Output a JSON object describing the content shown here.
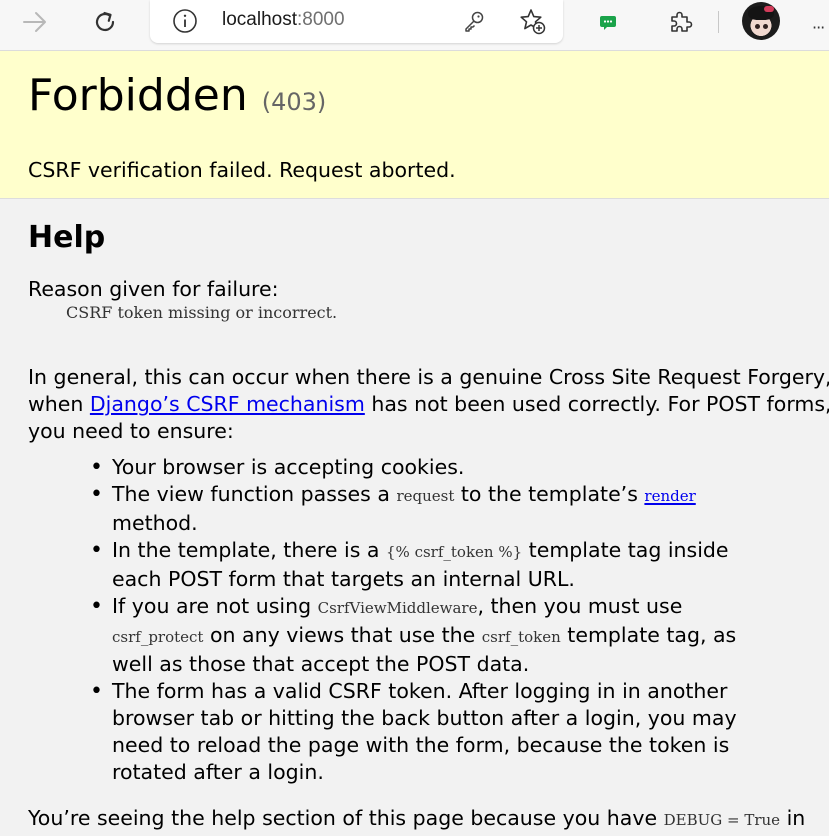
{
  "browser": {
    "url_host": "localhost",
    "url_port": ":8000"
  },
  "page": {
    "title": "Forbidden",
    "status_code": "(403)",
    "summary": "CSRF verification failed. Request aborted.",
    "help_heading": "Help",
    "reason_label": "Reason given for failure:",
    "reason_value": "CSRF token missing or incorrect.",
    "general_line1": "In general, this can occur when there is a genuine Cross Site Request Forgery, or",
    "general_line2_before": "when ",
    "general_link": "Django’s CSRF mechanism",
    "general_line2_after": " has not been used correctly. For POST forms,",
    "general_line3": "you need to ensure:",
    "items": [
      {
        "text": "Your browser is accepting cookies."
      },
      {
        "part1": "The view function passes a ",
        "code1": "request",
        "part2": " to the template’s ",
        "code2": "render",
        "part3": "method."
      },
      {
        "part1": "In the template, there is a ",
        "code1": "{% csrf_token %}",
        "part2": " template tag inside",
        "part3": "each POST form that targets an internal URL."
      },
      {
        "part1": "If you are not using ",
        "code1": "CsrfViewMiddleware",
        "part2": ", then you must use",
        "code2": "csrf_protect",
        "part3": " on any views that use the ",
        "code3": "csrf_token",
        "part4": " template tag, as",
        "part5": "well as those that accept the POST data."
      },
      {
        "line1": "The form has a valid CSRF token. After logging in in another",
        "line2": "browser tab or hitting the back button after a login, you may",
        "line3": "need to reload the page with the form, because the token is",
        "line4": "rotated after a login."
      }
    ],
    "footer_before": "You’re seeing the help section of this page because you have ",
    "footer_code": "DEBUG = True",
    "footer_after": " in"
  }
}
